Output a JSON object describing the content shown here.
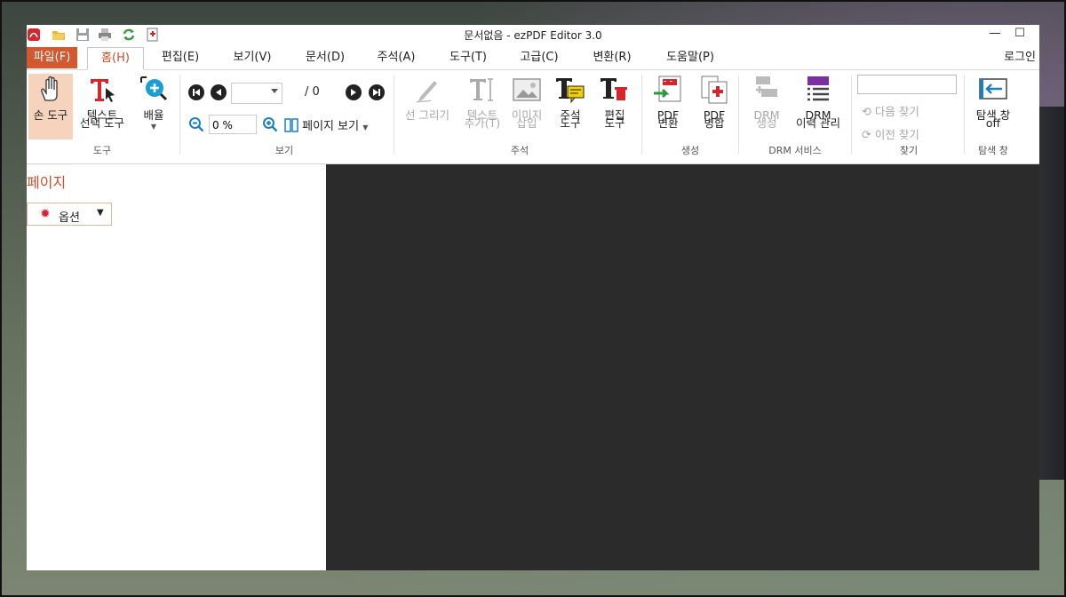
{
  "window": {
    "title": "문서없음 - ezPDF Editor 3.0"
  },
  "quick_access": [
    "acrobat-icon",
    "open-folder-icon",
    "save-icon",
    "print-icon",
    "refresh-icon",
    "insert-page-icon"
  ],
  "window_controls": {
    "minimize": "—",
    "maximize": "☐"
  },
  "menu": {
    "file": "파일(F)",
    "tabs": [
      "홈(H)",
      "편집(E)",
      "보기(V)",
      "문서(D)",
      "주석(A)",
      "도구(T)",
      "고급(C)",
      "변환(R)",
      "도움말(P)"
    ],
    "active_tab": "홈(H)",
    "login": "로그인"
  },
  "ribbon": {
    "tools": {
      "label": "도구",
      "hand": "손 도구",
      "text_select_1": "텍스트",
      "text_select_2": "선택 도구",
      "zoom": "배율"
    },
    "view": {
      "label": "보기",
      "page_total": "/ 0",
      "zoom_value": "0 %",
      "page_view": "페이지 보기"
    },
    "annotate": {
      "label": "주석",
      "draw_line": "선 그리기",
      "add_text_1": "텍스트",
      "add_text_2": "추가(T)",
      "image_1": "이미지",
      "image_2": "삽입",
      "annot_tool_1": "주석",
      "annot_tool_2": "도구",
      "edit_tool_1": "편집",
      "edit_tool_2": "도구"
    },
    "create": {
      "label": "생성",
      "pdf_convert_1": "PDF",
      "pdf_convert_2": "변환",
      "pdf_merge_1": "PDF",
      "pdf_merge_2": "병합"
    },
    "drm": {
      "label": "DRM 서비스",
      "drm_create_1": "DRM",
      "drm_create_2": "생성",
      "drm_history_1": "DRM",
      "drm_history_2": "이력 관리"
    },
    "find": {
      "label": "찾기",
      "next": "다음 찾기",
      "prev": "이전 찾기"
    },
    "nav_pane": {
      "label": "탐색 창",
      "btn_1": "탐색 창",
      "btn_2": "off"
    }
  },
  "left_panel": {
    "title": "페이지",
    "options": "옵션"
  },
  "colors": {
    "accent": "#d3572f",
    "viewer_bg": "#2b2b2b"
  }
}
